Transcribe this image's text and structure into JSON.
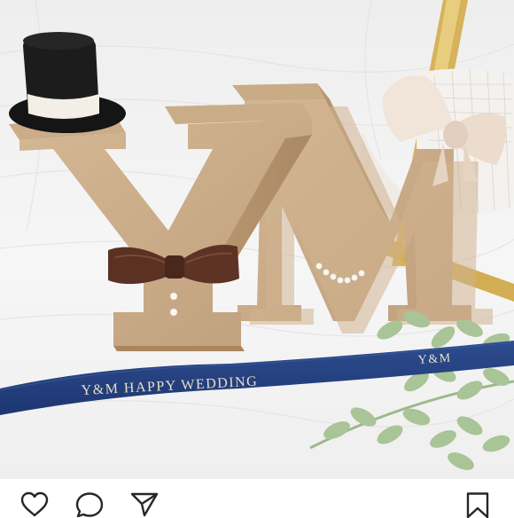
{
  "photo": {
    "ribbon_text_main": "Y&M  HAPPY WEDDING",
    "ribbon_text_end": "Y&M",
    "letters": [
      "Y",
      "M"
    ],
    "ribbon_color": "#23407e",
    "wood_color": "#c9ad8a"
  },
  "actions": {
    "like_icon": "heart-icon",
    "comment_icon": "comment-icon",
    "share_icon": "send-icon",
    "save_icon": "bookmark-icon"
  }
}
